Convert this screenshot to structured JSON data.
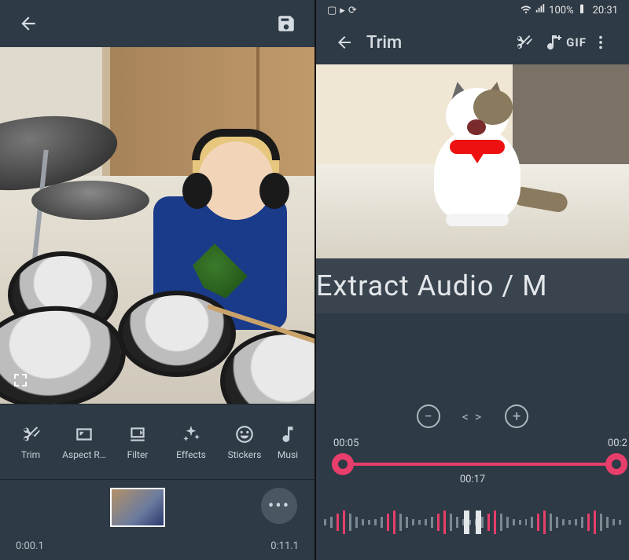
{
  "left": {
    "topbar": {
      "back": "←",
      "save": "save"
    },
    "tools": [
      {
        "name": "trim",
        "label": "Trim",
        "icon": "scissors"
      },
      {
        "name": "aspect",
        "label": "Aspect R…",
        "icon": "aspect"
      },
      {
        "name": "filter",
        "label": "Filter",
        "icon": "filter"
      },
      {
        "name": "effects",
        "label": "Effects",
        "icon": "sparkle"
      },
      {
        "name": "stickers",
        "label": "Stickers",
        "icon": "smiley"
      },
      {
        "name": "music",
        "label": "Musi",
        "icon": "note"
      }
    ],
    "timeline": {
      "start": "0:00.1",
      "end": "0:11.1"
    },
    "expand_icon": "expand"
  },
  "right": {
    "status": {
      "battery": "100%",
      "time": "20:31"
    },
    "topbar": {
      "title": "Trim",
      "actions": [
        {
          "name": "cut",
          "icon": "scissors"
        },
        {
          "name": "addmusic",
          "icon": "noteplus"
        },
        {
          "name": "gif",
          "label": "GIF"
        },
        {
          "name": "more",
          "icon": "more"
        }
      ]
    },
    "overlay_text": "Extract Audio / M",
    "zoom": {
      "out": "−",
      "fit": "< >",
      "in": "+"
    },
    "trim": {
      "start": "00:05",
      "end": "00:2",
      "current": "00:17"
    }
  }
}
